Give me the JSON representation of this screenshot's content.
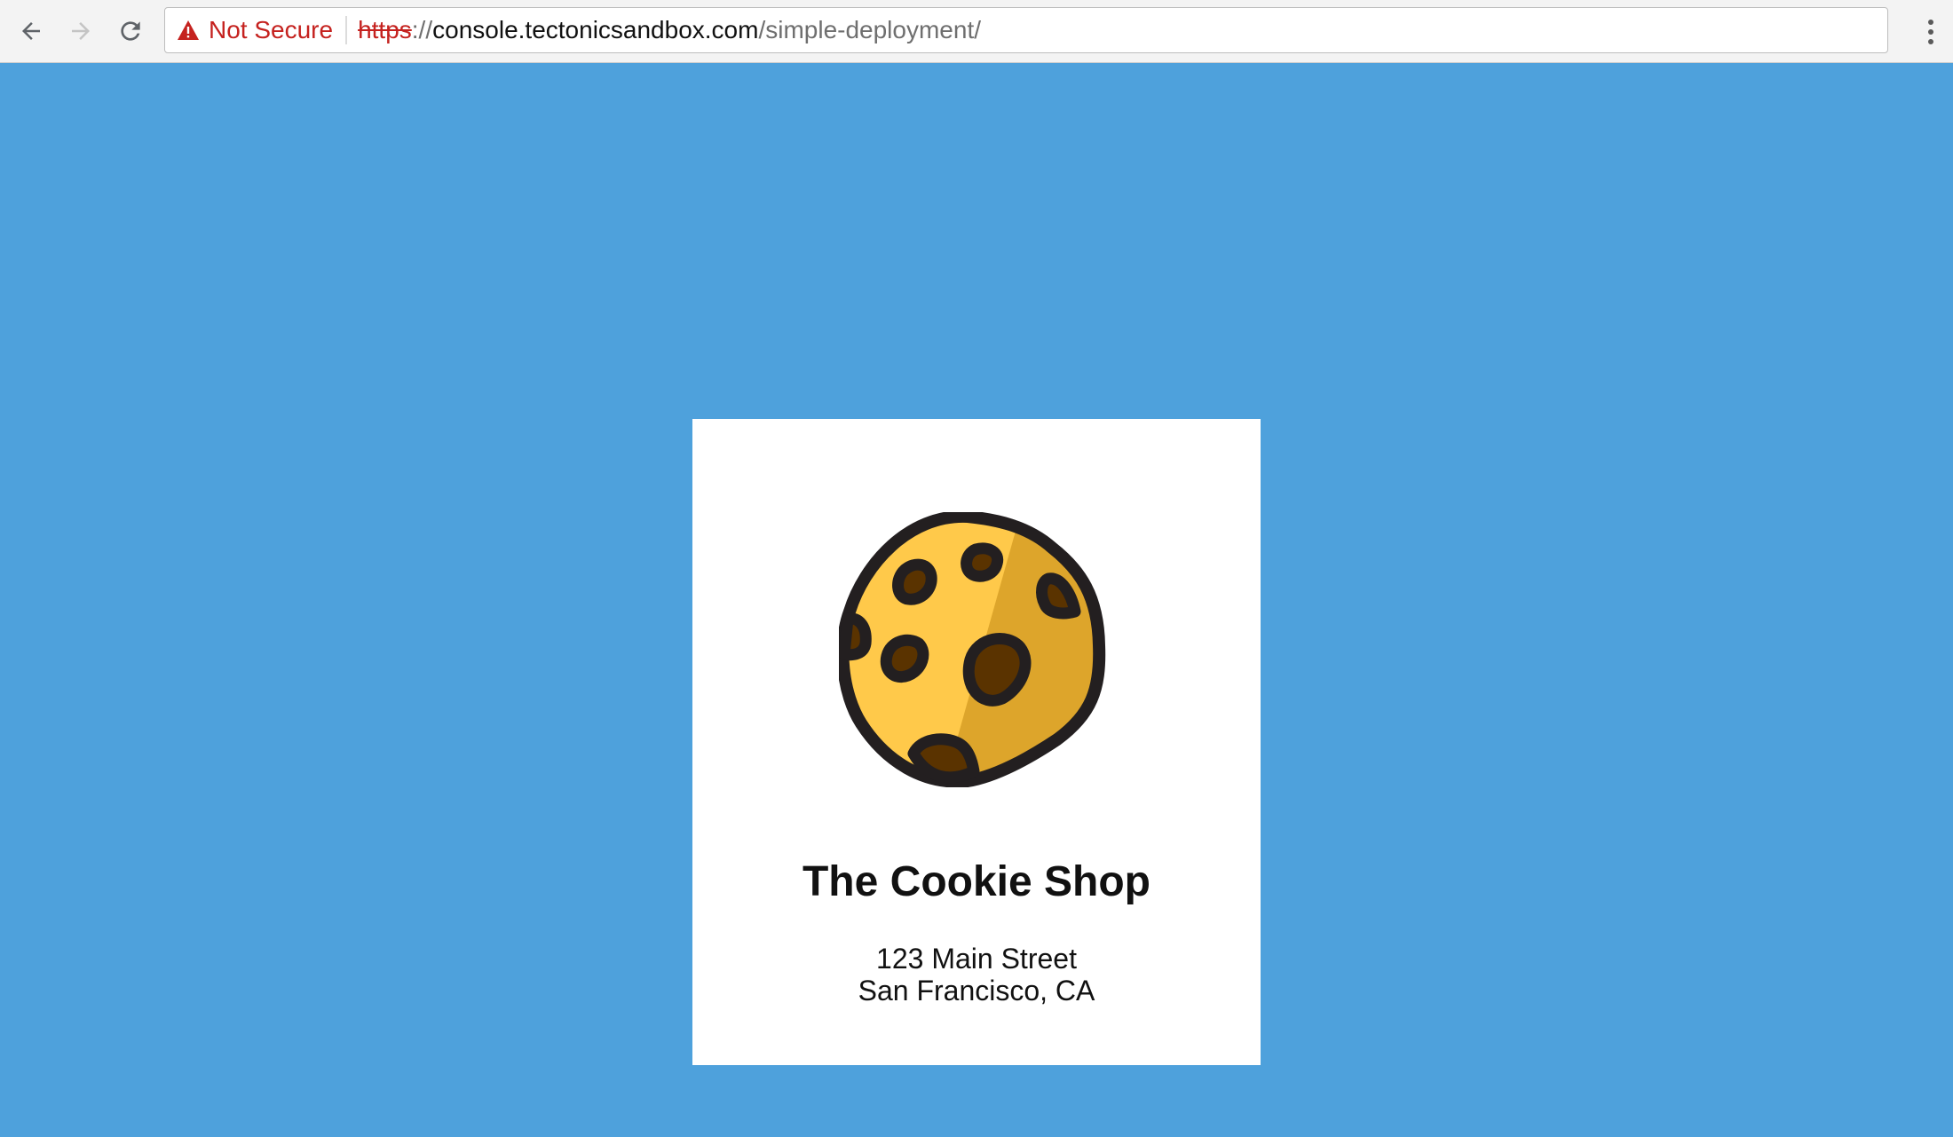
{
  "browser": {
    "security_label": "Not Secure",
    "url_scheme": "https",
    "url_separator": "://",
    "url_host": "console.tectonicsandbox.com",
    "url_path": "/simple-deployment/",
    "colors": {
      "insecure": "#c5221f",
      "toolbar_bg": "#f3f3f3"
    }
  },
  "page": {
    "background_color": "#4ea1dc",
    "logo_icon": "cookie-icon",
    "shop_name": "The Cookie Shop",
    "address_line1": "123 Main Street",
    "address_line2": "San Francisco, CA"
  }
}
